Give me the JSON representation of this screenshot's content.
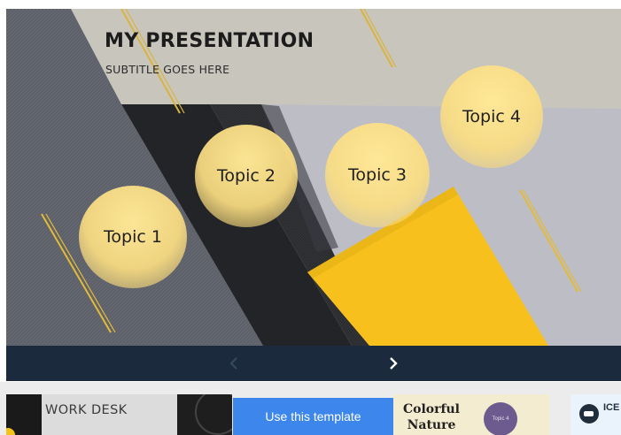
{
  "slide": {
    "title": "MY PRESENTATION",
    "subtitle": "SUBTITLE GOES HERE",
    "topics": [
      "Topic 1",
      "Topic 2",
      "Topic 3",
      "Topic 4"
    ]
  },
  "nav": {
    "prev_icon": "chevron-left-icon",
    "next_icon": "chevron-right-icon"
  },
  "thumbnails": [
    {
      "name": "WORK DESK"
    },
    {
      "name": "Colorful Nature",
      "topic": "Topic 4"
    },
    {
      "name": "ICE"
    }
  ],
  "cta": {
    "label": "Use this template"
  },
  "colors": {
    "navbar": "#1b2a3d",
    "cta": "#3d86ec",
    "accent_yellow": "#f9c21b",
    "topic_fill": "#fbe08a"
  }
}
